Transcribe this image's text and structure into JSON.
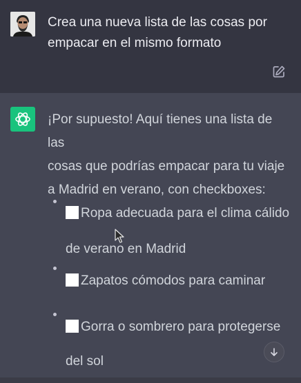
{
  "user_message": {
    "line1": "Crea una nueva lista de las cosas por",
    "line2": "empacar en el mismo formato"
  },
  "assistant_message": {
    "intro_line1": "¡Por supuesto! Aquí tienes una lista de las",
    "intro_line2": "cosas que podrías empacar para tu viaje",
    "intro_line3": "a Madrid en verano, con checkboxes:",
    "items": [
      {
        "line1": "Ropa adecuada para el clima cálido",
        "line2": "de verano en Madrid"
      },
      {
        "line1": "Zapatos cómodos para caminar"
      },
      {
        "line1": "Gorra o sombrero para protegerse",
        "line2": "del sol"
      }
    ]
  },
  "icons": {
    "edit": "edit-icon",
    "assistant_logo": "openai-logo-icon",
    "scroll_down": "arrow-down-icon"
  },
  "colors": {
    "user_bg": "#343541",
    "assistant_bg": "#444654",
    "logo_green": "#19c37d"
  }
}
